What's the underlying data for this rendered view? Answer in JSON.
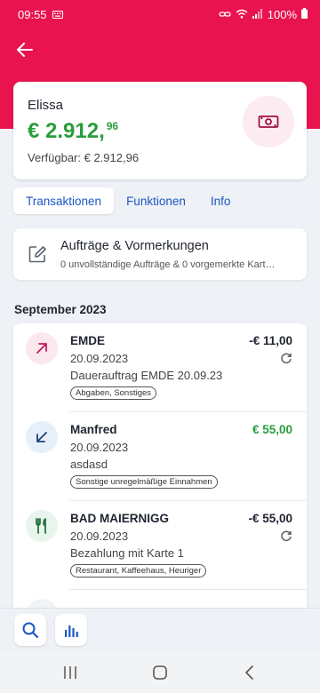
{
  "status_bar": {
    "time": "09:55",
    "battery": "100%"
  },
  "account": {
    "name": "Elissa",
    "balance_main": "€ 2.912,",
    "balance_cents": "96",
    "available": "Verfügbar: € 2.912,96"
  },
  "tabs": [
    {
      "label": "Transaktionen",
      "active": true
    },
    {
      "label": "Funktionen",
      "active": false
    },
    {
      "label": "Info",
      "active": false
    }
  ],
  "orders": {
    "title": "Aufträge & Vormerkungen",
    "subtitle": "0 unvollständige Aufträge & 0 vorgemerkte Kart…"
  },
  "month_header": "September 2023",
  "transactions": [
    {
      "name": "EMDE",
      "date": "20.09.2023",
      "description": "Dauerauftrag EMDE 20.09.23",
      "category": "Abgaben, Sonstiges",
      "amount": "-€ 11,00",
      "direction": "outgoing",
      "icon": "arrow-up-right-icon",
      "recurring": true
    },
    {
      "name": "Manfred",
      "date": "20.09.2023",
      "description": "asdasd",
      "category": "Sonstige unregelmäßige Einnahmen",
      "amount": "€ 55,00",
      "direction": "incoming",
      "icon": "arrow-down-left-icon",
      "recurring": false
    },
    {
      "name": "BAD MAIERNIGG",
      "date": "20.09.2023",
      "description": "Bezahlung mit Karte 1",
      "category": "Restaurant, Kaffeehaus, Heuriger",
      "amount": "-€ 55,00",
      "direction": "outgoing",
      "icon": "fork-knife-icon",
      "recurring": true
    }
  ],
  "colors": {
    "brand": "#e8134f",
    "positive": "#2a9d3b",
    "link": "#1a56c4"
  }
}
